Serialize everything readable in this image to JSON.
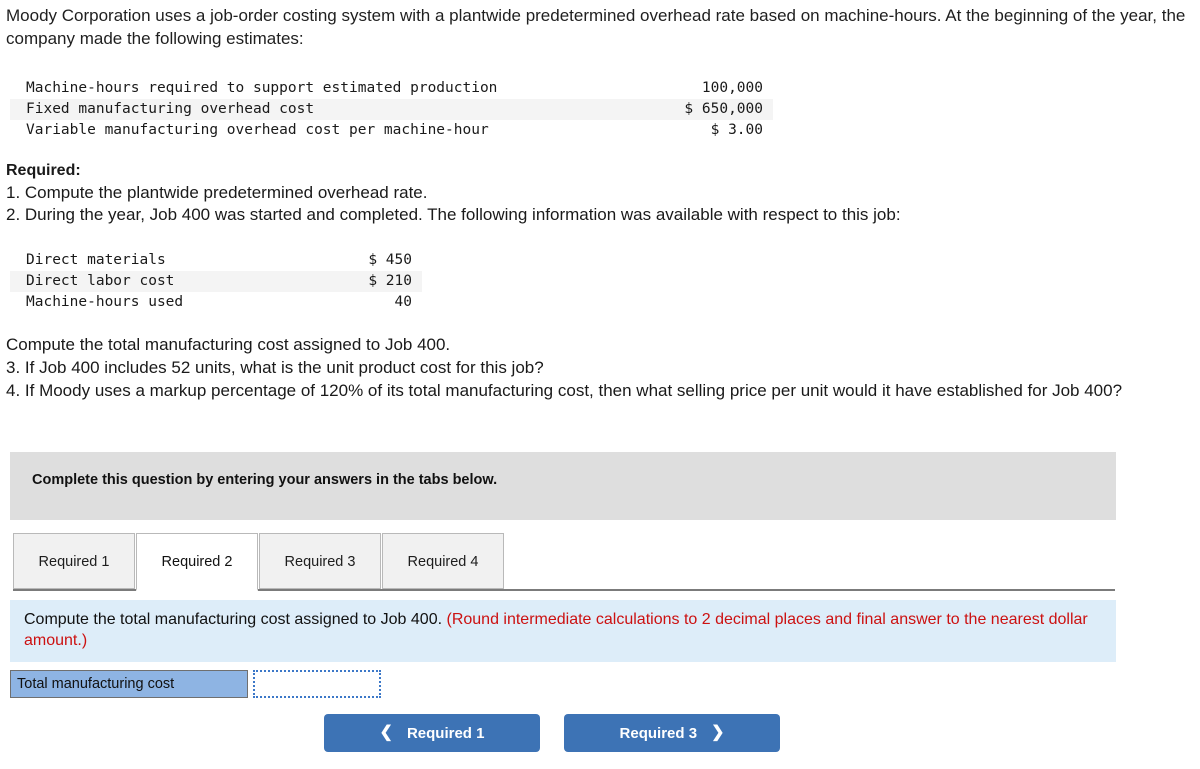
{
  "problem": {
    "stem": "Moody Corporation uses a job-order costing system with a plantwide predetermined overhead rate based on machine-hours. At the beginning of the year, the company made the following estimates:",
    "estimates_table": {
      "rows": [
        {
          "label": "Machine-hours required to support estimated production",
          "value": "100,000",
          "shaded": false
        },
        {
          "label": "Fixed manufacturing overhead cost",
          "value": "$ 650,000",
          "shaded": true
        },
        {
          "label": "Variable manufacturing overhead cost per machine-hour",
          "value": "$ 3.00",
          "shaded": false
        }
      ]
    },
    "required_heading": "Required:",
    "required_items": [
      "1. Compute the plantwide predetermined overhead rate.",
      "2. During the year, Job 400 was started and completed. The following information was available with respect to this job:"
    ],
    "job_table": {
      "rows": [
        {
          "label": "Direct materials",
          "value": "$ 450",
          "shaded": false
        },
        {
          "label": "Direct labor cost",
          "value": "$ 210",
          "shaded": true
        },
        {
          "label": "Machine-hours used",
          "value": "40",
          "shaded": false
        }
      ]
    },
    "tail_items": [
      "Compute the total manufacturing cost assigned to Job 400.",
      "3. If Job 400 includes 52 units, what is the unit product cost for this job?",
      "4. If Moody uses a markup percentage of 120% of its total manufacturing cost, then what selling price per unit would it have established for Job 400?"
    ]
  },
  "banner": {
    "text": "Complete this question by entering your answers in the tabs below."
  },
  "tabs": {
    "items": [
      {
        "label": "Required 1",
        "active": false
      },
      {
        "label": "Required 2",
        "active": true
      },
      {
        "label": "Required 3",
        "active": false
      },
      {
        "label": "Required 4",
        "active": false
      }
    ]
  },
  "instruction": {
    "main": "Compute the total manufacturing cost assigned to Job 400.",
    "note": "(Round intermediate calculations to 2 decimal places and final answer to the nearest dollar amount.)"
  },
  "answer": {
    "label": "Total manufacturing cost",
    "value": "",
    "placeholder": ""
  },
  "nav": {
    "prev_label": "Required 1",
    "next_label": "Required 3",
    "prev_icon": "chevron-left-icon",
    "next_icon": "chevron-right-icon"
  },
  "colors": {
    "banner_gray": "#dedede",
    "instruction_blue": "#ddedf9",
    "note_red": "#cc1111",
    "answer_label_blue": "#8eb4e3",
    "button_blue": "#3d73b5",
    "table_shade": "#f4f4f4"
  }
}
